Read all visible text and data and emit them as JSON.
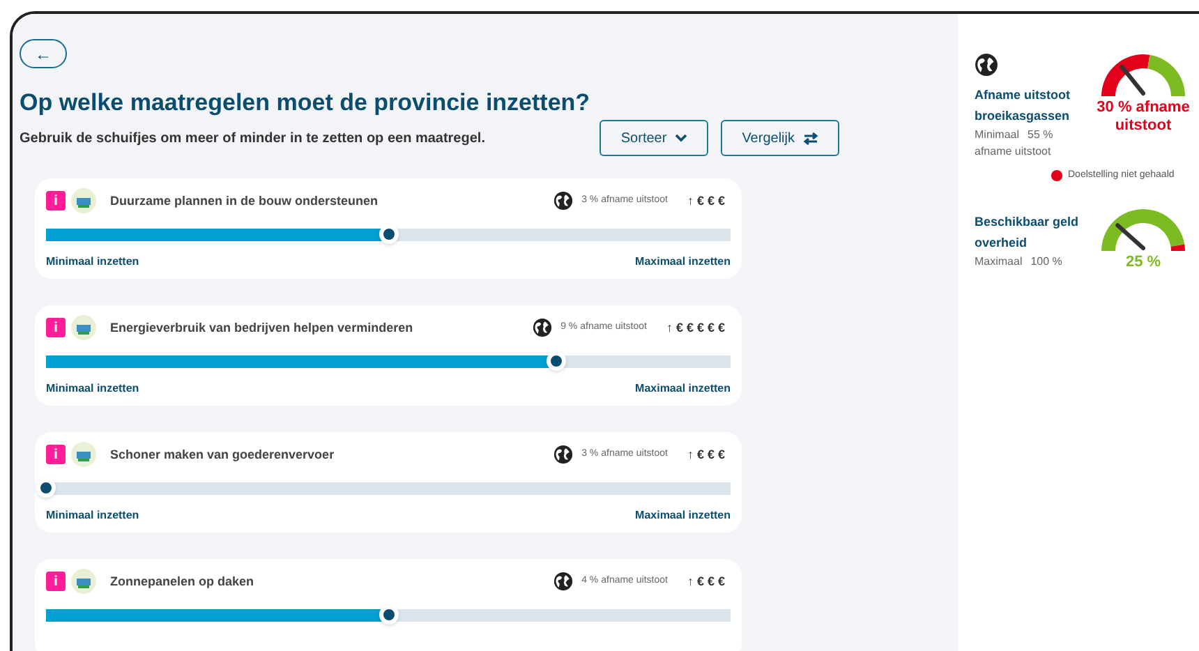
{
  "back_button": {
    "icon": "←"
  },
  "header": {
    "title": "Op welke maatregelen moet de provincie inzetten?",
    "subtitle": "Gebruik de schuifjes om meer of minder in te zetten op een maatregel.",
    "buttons": [
      {
        "label": "Sorteer",
        "kind": "sort"
      },
      {
        "label": "Vergelijk",
        "kind": "compare"
      }
    ]
  },
  "measures": [
    {
      "info": "i",
      "title": "Duurzame plannen in de bouw ondersteunen",
      "reduction": "3 % afname uitstoot",
      "cost": "↑ € € €",
      "level": 0.5,
      "min_label": "Minimaal inzetten",
      "max_label": "Maximaal inzetten"
    },
    {
      "info": "i",
      "title": "Energieverbruik van bedrijven helpen verminderen",
      "reduction": "9 % afname uitstoot",
      "cost": "↑ € € € € €",
      "level": 0.745,
      "min_label": "Minimaal inzetten",
      "max_label": "Maximaal inzetten"
    },
    {
      "info": "i",
      "title": "Schoner maken van goederenvervoer",
      "reduction": "3 % afname uitstoot",
      "cost": "↑ € € €",
      "level": 0,
      "min_label": "Minimaal inzetten",
      "max_label": "Maximaal inzetten"
    },
    {
      "info": "i",
      "title": "Zonnepanelen op daken",
      "reduction": "4 % afname uitstoot",
      "cost": "↑ € € €",
      "level": 0.5
    }
  ],
  "summary": [
    {
      "kind": "emissions",
      "title": "Afname uitstoot broeikasgassen",
      "target_label": "Minimaal",
      "target_value": "55 %",
      "target_suffix": "afname uitstoot",
      "result": "30 % afname uitstoot",
      "level": 0.3,
      "warning": "Doelstelling niet gehaald"
    },
    {
      "kind": "budget",
      "title": "Beschikbaar geld overheid",
      "target_label": "Maximaal",
      "target_value": "100 %",
      "result": "25 %",
      "level": 0.25
    }
  ]
}
